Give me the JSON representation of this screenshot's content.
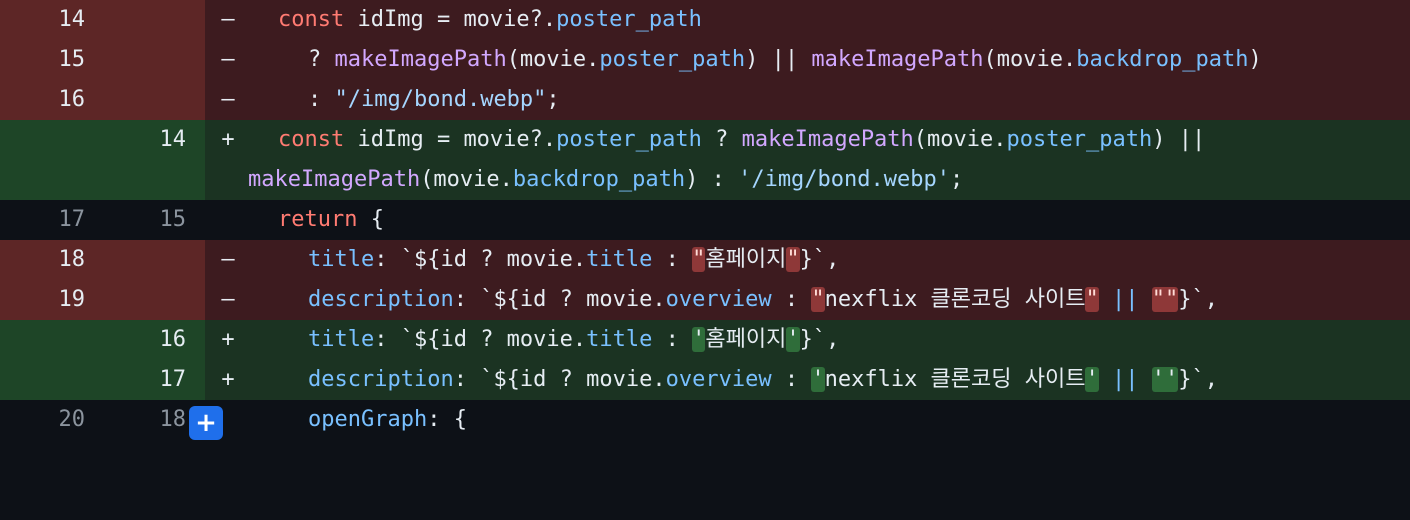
{
  "rows": [
    {
      "type": "del",
      "old": "14",
      "new": "",
      "sign": "–",
      "segments": [
        "const",
        " idImg = movie?.",
        "poster_path"
      ]
    },
    {
      "type": "del",
      "old": "15",
      "new": "",
      "sign": "–",
      "segments": [
        "? ",
        "makeImagePath",
        "(movie.",
        "poster_path",
        ") || ",
        "makeImagePath",
        "(movie.",
        "backdrop_path",
        ")"
      ]
    },
    {
      "type": "del",
      "old": "16",
      "new": "",
      "sign": "–",
      "segments": [
        ": ",
        "\"/img/bond.webp\"",
        ";"
      ]
    },
    {
      "type": "add",
      "old": "",
      "new": "14",
      "sign": "+",
      "segments": [
        "const",
        " idImg = movie?.",
        "poster_path",
        " ? ",
        "makeImagePath",
        "(movie.",
        "poster_path",
        ") ||"
      ],
      "wrap": [
        "makeImagePath",
        "(movie.",
        "backdrop_path",
        ") : ",
        "'/img/bond.webp'",
        ";"
      ]
    },
    {
      "type": "ctx",
      "old": "17",
      "new": "15",
      "sign": "",
      "segments": [
        "return",
        " {"
      ]
    },
    {
      "type": "del",
      "old": "18",
      "new": "",
      "sign": "–",
      "segments": [
        "title",
        ": `${id ? movie.",
        "title",
        " : ",
        "\"",
        "홈페이지",
        "\"",
        "}`,"
      ]
    },
    {
      "type": "del",
      "old": "19",
      "new": "",
      "sign": "–",
      "segments": [
        "description",
        ": `${id ? movie.",
        "overview",
        " : ",
        "\"",
        "nexflix 클론코딩 사이트",
        "\"",
        " || ",
        "\"\"",
        "}`,"
      ]
    },
    {
      "type": "add",
      "old": "",
      "new": "16",
      "sign": "+",
      "segments": [
        "title",
        ": `${id ? movie.",
        "title",
        " : ",
        "'",
        "홈페이지",
        "'",
        "}`,"
      ]
    },
    {
      "type": "add",
      "old": "",
      "new": "17",
      "sign": "+",
      "segments": [
        "description",
        ": `${id ? movie.",
        "overview",
        " : ",
        "'",
        "nexflix 클론코딩 사이트",
        "'",
        " || ",
        "''",
        "}`,"
      ]
    },
    {
      "type": "ctx",
      "old": "20",
      "new": "18",
      "sign": "",
      "segments": [
        "openGraph",
        ": {"
      ]
    }
  ],
  "expand_button": "+"
}
